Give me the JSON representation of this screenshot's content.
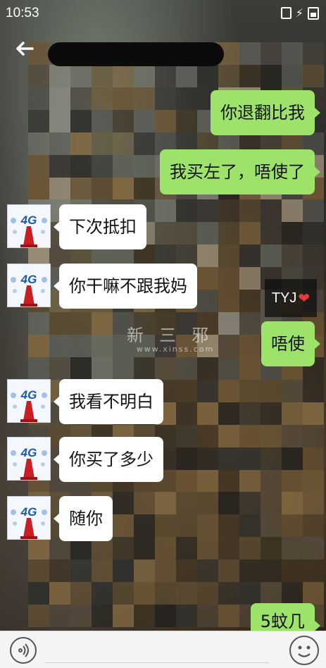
{
  "status_bar": {
    "time": "10:53"
  },
  "messages": [
    {
      "side": "out",
      "text": "你退翻比我"
    },
    {
      "side": "out",
      "text": "我买左了，唔使了"
    },
    {
      "side": "in",
      "text": "下次抵扣"
    },
    {
      "side": "in",
      "text": "你干嘛不跟我妈"
    },
    {
      "side": "out",
      "text": "唔使"
    },
    {
      "side": "in",
      "text": "我看不明白"
    },
    {
      "side": "in",
      "text": "你买了多少"
    },
    {
      "side": "in",
      "text": "随你"
    },
    {
      "side": "out",
      "text": "5蚊几"
    }
  ],
  "avatar": {
    "label": "4G"
  },
  "overlay_tag": {
    "text": "TYJ",
    "icon": "heart-icon"
  },
  "watermark": {
    "title": "新三邪",
    "url": "www.xinss.com"
  },
  "icons": {
    "back": "back-arrow-icon",
    "voice": "voice-icon",
    "emoji": "emoji-icon"
  },
  "colors": {
    "outgoing_bubble": "#9de36b",
    "incoming_bubble": "#ffffff",
    "input_bar": "#f4f4f4"
  }
}
